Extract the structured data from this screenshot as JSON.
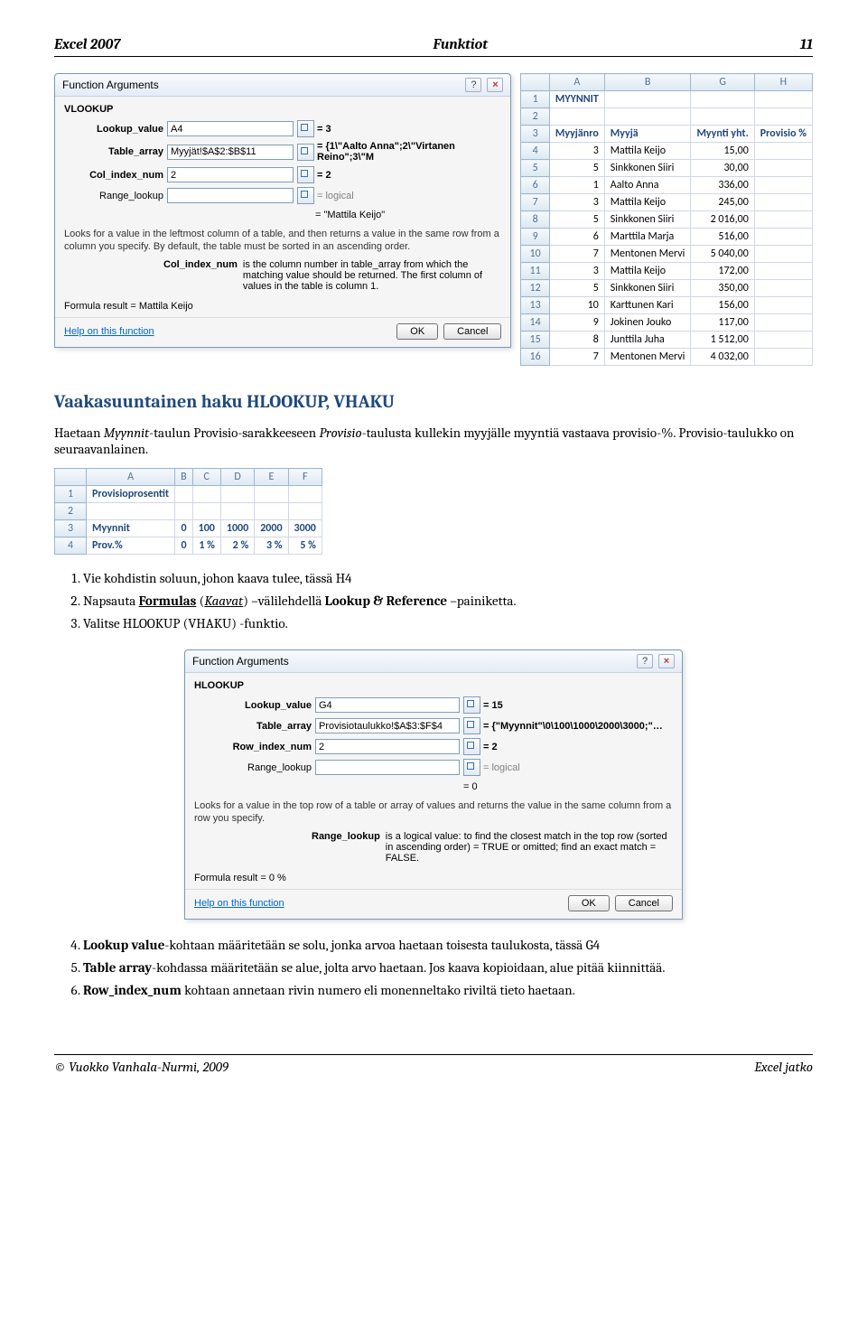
{
  "header": {
    "left": "Excel 2007",
    "center": "Funktiot",
    "right": "11"
  },
  "dialog1": {
    "title": "Function Arguments",
    "fname": "VLOOKUP",
    "args": [
      {
        "label": "Lookup_value",
        "value": "A4",
        "result": "= 3",
        "bold": true
      },
      {
        "label": "Table_array",
        "value": "Myyjät!$A$2:$B$11",
        "result": "= {1\\\"Aalto Anna\";2\\\"Virtanen Reino\";3\\\"M",
        "bold": true
      },
      {
        "label": "Col_index_num",
        "value": "2",
        "result": "= 2",
        "bold": true
      },
      {
        "label": "Range_lookup",
        "value": "",
        "result": "= logical",
        "bold": false
      }
    ],
    "fn_result": "= \"Mattila Keijo\"",
    "desc": "Looks for a value in the leftmost column of a table, and then returns a value in the same row from a column you specify. By default, the table must be sorted in an ascending order.",
    "param_name": "Col_index_num",
    "param_text": "is the column number in table_array from which the matching value should be returned. The first column of values in the table is column 1.",
    "formula_result_label": "Formula result =",
    "formula_result_value": "Mattila Keijo",
    "help": "Help on this function",
    "ok": "OK",
    "cancel": "Cancel"
  },
  "grid1": {
    "cols": [
      "",
      "A",
      "B",
      "G",
      "H"
    ],
    "rows": [
      [
        "1",
        "MYYNNIT",
        "",
        "",
        ""
      ],
      [
        "2",
        "",
        "",
        "",
        ""
      ],
      [
        "3",
        "Myyjänro",
        "Myyjä",
        "Myynti yht.",
        "Provisio %"
      ],
      [
        "4",
        "3",
        "Mattila Keijo",
        "15,00",
        ""
      ],
      [
        "5",
        "5",
        "Sinkkonen Siiri",
        "30,00",
        ""
      ],
      [
        "6",
        "1",
        "Aalto Anna",
        "336,00",
        ""
      ],
      [
        "7",
        "3",
        "Mattila Keijo",
        "245,00",
        ""
      ],
      [
        "8",
        "5",
        "Sinkkonen Siiri",
        "2 016,00",
        ""
      ],
      [
        "9",
        "6",
        "Marttila Marja",
        "516,00",
        ""
      ],
      [
        "10",
        "7",
        "Mentonen Mervi",
        "5 040,00",
        ""
      ],
      [
        "11",
        "3",
        "Mattila Keijo",
        "172,00",
        ""
      ],
      [
        "12",
        "5",
        "Sinkkonen Siiri",
        "350,00",
        ""
      ],
      [
        "13",
        "10",
        "Karttunen Kari",
        "156,00",
        ""
      ],
      [
        "14",
        "9",
        "Jokinen Jouko",
        "117,00",
        ""
      ],
      [
        "15",
        "8",
        "Junttila Juha",
        "1 512,00",
        ""
      ],
      [
        "16",
        "7",
        "Mentonen Mervi",
        "4 032,00",
        ""
      ]
    ]
  },
  "section_title": "Vaakasuuntainen haku HLOOKUP, VHAKU",
  "intro": {
    "p1a": "Haetaan ",
    "p1b": "Myynnit",
    "p1c": "-taulun Provisio-sarakkeeseen  ",
    "p1d": "Provisio",
    "p1e": "-taulusta kullekin myyjälle myyntiä vastaava provisio-%. Provisio-taulukko on seuraavanlainen."
  },
  "grid2": {
    "cols": [
      "",
      "A",
      "B",
      "C",
      "D",
      "E",
      "F"
    ],
    "rows": [
      [
        "1",
        "Provisioprosentit",
        "",
        "",
        "",
        "",
        ""
      ],
      [
        "2",
        "",
        "",
        "",
        "",
        "",
        ""
      ],
      [
        "3",
        "Myynnit",
        "0",
        "100",
        "1000",
        "2000",
        "3000"
      ],
      [
        "4",
        "Prov.%",
        "0",
        "1 %",
        "2 %",
        "3 %",
        "5 %"
      ]
    ]
  },
  "steps1": [
    "Vie kohdistin soluun, johon kaava tulee, tässä H4",
    {
      "pre": "Napsauta ",
      "b": "Formulas",
      "mid": " (",
      "i": "Kaavat",
      "post": ") –välilehdellä  ",
      "b2": "Lookup & Reference",
      "end": " –painiketta."
    },
    "Valitse HLOOKUP  (VHAKU) -funktio."
  ],
  "dialog2": {
    "title": "Function Arguments",
    "fname": "HLOOKUP",
    "args": [
      {
        "label": "Lookup_value",
        "value": "G4",
        "result": "= 15",
        "bold": true
      },
      {
        "label": "Table_array",
        "value": "Provisiotaulukko!$A$3:$F$4",
        "result": "= {\"Myynnit\"\\0\\100\\1000\\2000\\3000;\"…",
        "bold": true
      },
      {
        "label": "Row_index_num",
        "value": "2",
        "result": "= 2",
        "bold": true
      },
      {
        "label": "Range_lookup",
        "value": "",
        "result": "= logical",
        "bold": false
      }
    ],
    "fn_result": "= 0",
    "desc": "Looks for a value in the top row of a table or array of values and returns the value in the same column from a row you specify.",
    "param_name": "Range_lookup",
    "param_text": "is a logical value: to find the closest match in the top row (sorted in ascending order) = TRUE or omitted; find an exact match = FALSE.",
    "formula_result_label": "Formula result =",
    "formula_result_value": "0 %",
    "help": "Help on this function",
    "ok": "OK",
    "cancel": "Cancel"
  },
  "steps2": [
    {
      "b": "Lookup value",
      "post": "-kohtaan määritetään se solu, jonka arvoa haetaan toisesta taulukosta, tässä G4"
    },
    {
      "b": "Table array",
      "post": "-kohdassa määritetään se alue, jolta arvo haetaan. Jos kaava kopioidaan, alue pitää kiinnittää."
    },
    {
      "b": "Row_index_num",
      "post": " kohtaan annetaan rivin numero eli monenneltako riviltä tieto haetaan."
    }
  ],
  "footer": {
    "left": "© Vuokko Vanhala-Nurmi, 2009",
    "right": "Excel jatko"
  }
}
